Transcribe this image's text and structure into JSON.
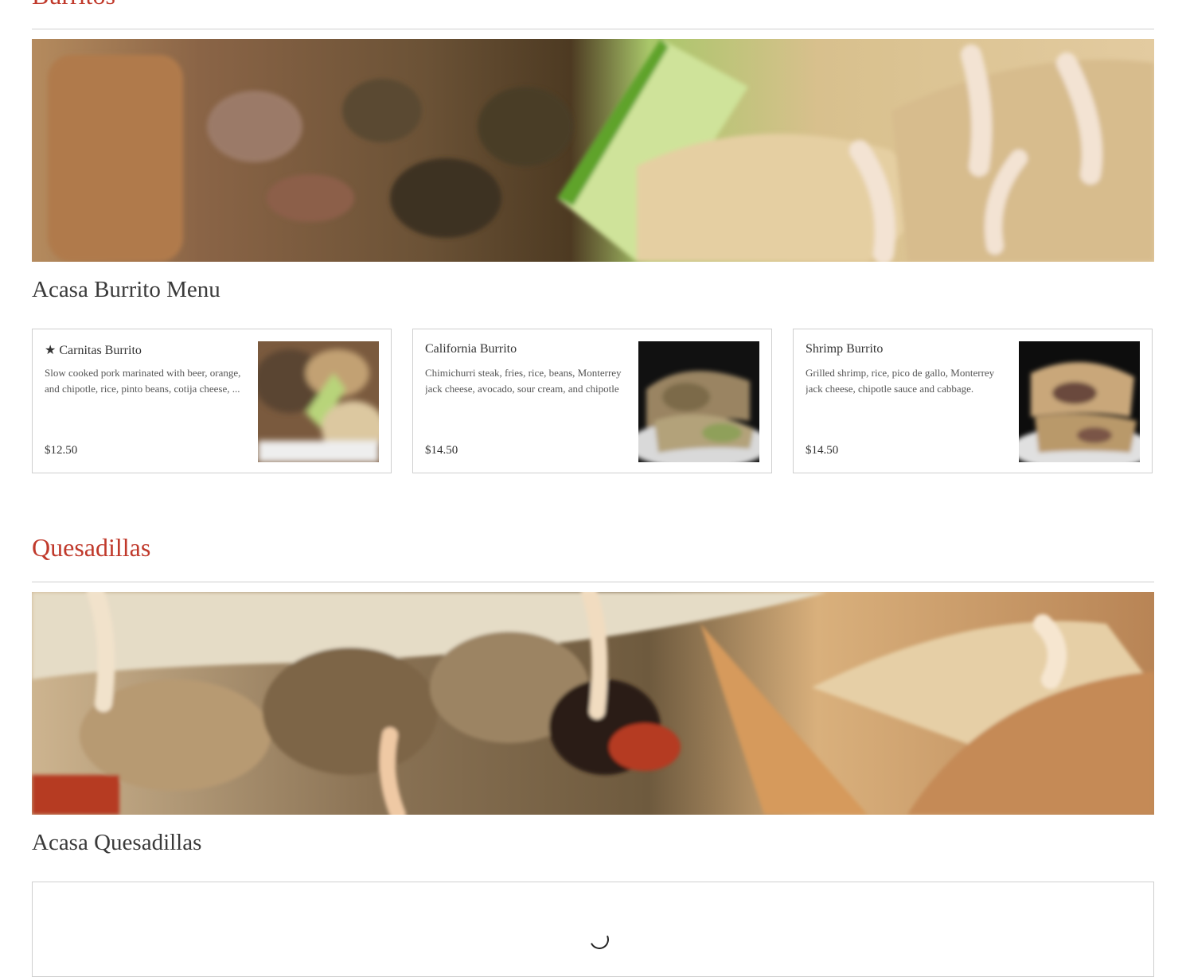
{
  "colors": {
    "accent": "#c0392b",
    "text": "#333333",
    "border": "#cfcfcf"
  },
  "sections": [
    {
      "title": "Burritos",
      "menu_title": "Acasa Burrito Menu",
      "items": [
        {
          "name": "★ Carnitas Burrito",
          "description": "Slow cooked pork marinated with beer, orange, and chipotle, rice, pinto beans, cotija cheese, ...",
          "price": "$12.50"
        },
        {
          "name": "California Burrito",
          "description": "Chimichurri steak, fries, rice, beans, Monterrey jack cheese, avocado, sour cream, and chipotle ...",
          "price": "$14.50"
        },
        {
          "name": "Shrimp Burrito",
          "description": "Grilled shrimp, rice, pico de gallo, Monterrey jack cheese, chipotle sauce and cabbage.",
          "price": "$14.50"
        }
      ]
    },
    {
      "title": "Quesadillas",
      "menu_title": "Acasa Quesadillas"
    }
  ]
}
